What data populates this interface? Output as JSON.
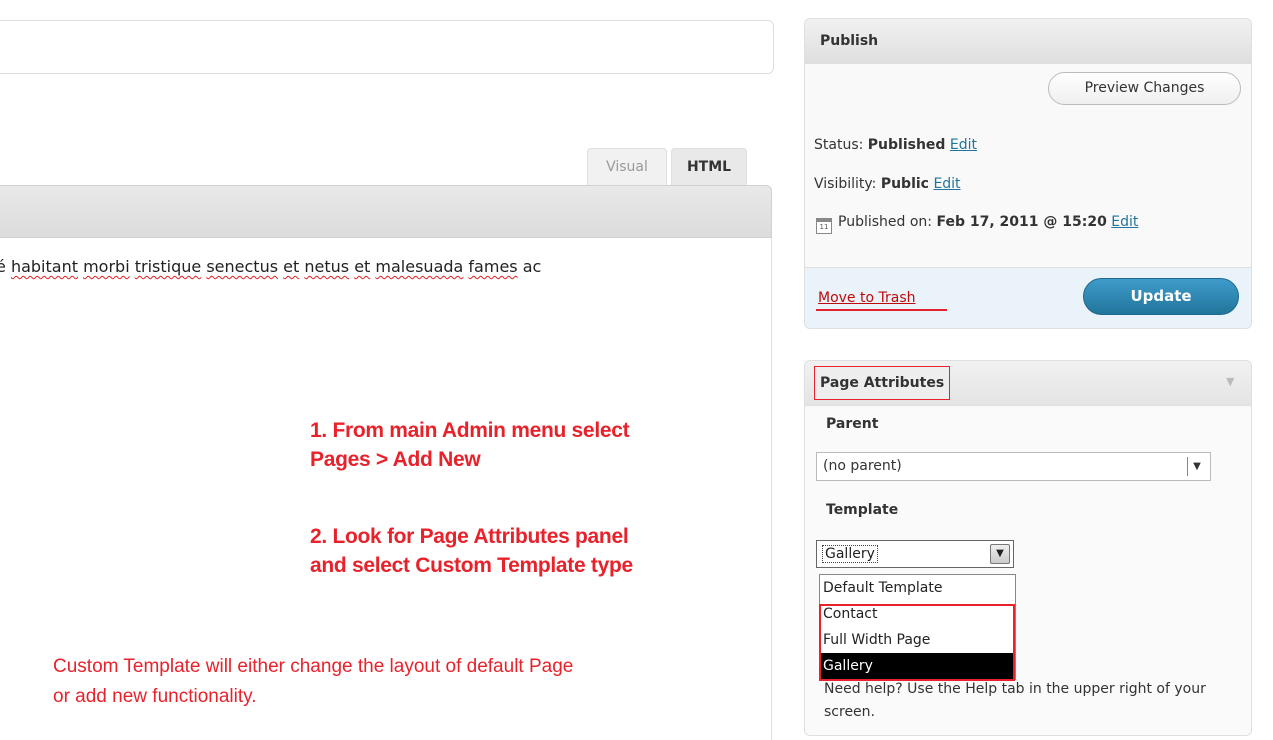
{
  "editor": {
    "tabs": [
      "Visual",
      "HTML"
    ],
    "text_pre": "é ",
    "words": [
      "habitant",
      "morbi",
      "tristique",
      "senectus",
      "et",
      "netus",
      "et",
      "malesuada",
      "fames"
    ],
    "text_post": "ac"
  },
  "instructions": {
    "step1": [
      "1. From main Admin menu select",
      "Pages > Add New"
    ],
    "step2": [
      "2. Look for Page Attributes panel",
      "and select Custom Template type"
    ],
    "note": [
      "Custom Template will either change the layout of default Page",
      "or add new functionality."
    ]
  },
  "publish": {
    "title": "Publish",
    "preview_label": "Preview Changes",
    "status_label": "Status:",
    "status_value": "Published",
    "visibility_label": "Visibility:",
    "visibility_value": "Public",
    "date_label": "Published on:",
    "date_value": "Feb 17, 2011 @ 15:20",
    "edit_label": "Edit",
    "trash_label": "Move to Trash",
    "update_label": "Update"
  },
  "attributes": {
    "title": "Page Attributes",
    "parent_label": "Parent",
    "parent_value": "(no parent)",
    "template_label": "Template",
    "template_value": "Gallery",
    "template_options": [
      "Default Template",
      "Contact",
      "Full Width Page",
      "Gallery"
    ],
    "selected_option": "Gallery",
    "help_text": "Need help? Use the Help tab in the upper right of your screen."
  },
  "colors": {
    "annotation": "#e8222b",
    "link": "#21759b",
    "update_button": "#21759b",
    "trash": "#bc0b0b"
  },
  "icons": [
    "calendar-icon",
    "chevron-down-icon",
    "toggle-arrow-icon"
  ]
}
